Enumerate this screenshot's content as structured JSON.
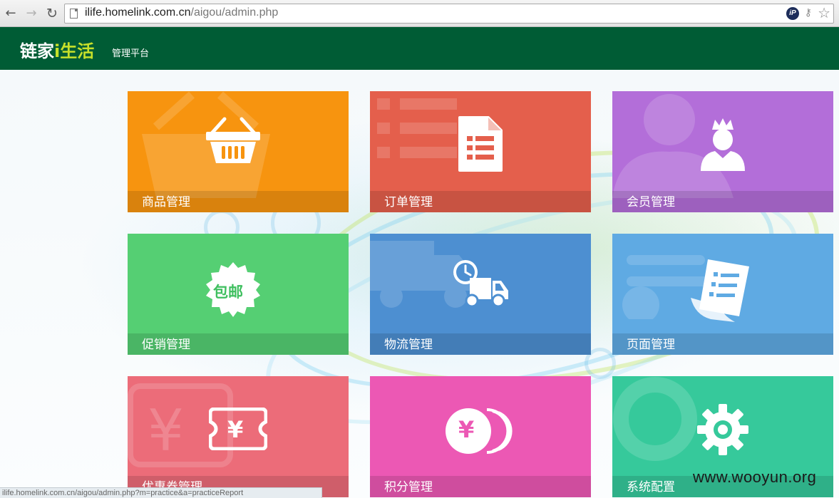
{
  "browser": {
    "url_host": "ilife.homelink.com.cn",
    "url_path": "/aigou/admin.php",
    "icons": [
      "back-arrow-icon",
      "forward-arrow-icon",
      "reload-icon",
      "page-icon",
      "ip-badge-icon",
      "key-icon",
      "bookmark-star-icon"
    ],
    "ip_badge": "iP"
  },
  "header": {
    "logo_main": "链家",
    "logo_accent": "i生活",
    "subtitle": "管理平台",
    "background": "#005c35"
  },
  "tiles": [
    {
      "label": "商品管理",
      "icon": "shopping-basket-icon",
      "color": "#f7940f"
    },
    {
      "label": "订单管理",
      "icon": "order-document-icon",
      "color": "#e45f4c"
    },
    {
      "label": "会员管理",
      "icon": "member-crown-icon",
      "color": "#b36ed9"
    },
    {
      "label": "促销管理",
      "icon": "free-shipping-badge-icon",
      "color": "#55cf73",
      "badge_text": "包邮"
    },
    {
      "label": "物流管理",
      "icon": "delivery-truck-icon",
      "color": "#4d8fd1"
    },
    {
      "label": "页面管理",
      "icon": "page-scroll-icon",
      "color": "#5faae3"
    },
    {
      "label": "优惠券管理",
      "icon": "coupon-ticket-icon",
      "color": "#ec6c79",
      "symbol": "¥"
    },
    {
      "label": "积分管理",
      "icon": "points-coins-icon",
      "color": "#ec58b4",
      "symbol": "¥"
    },
    {
      "label": "系统配置",
      "icon": "settings-gear-icon",
      "color": "#36c99b"
    }
  ],
  "status_bar": {
    "text": "ilife.homelink.com.cn/aigou/admin.php?m=practice&a=practiceReport"
  },
  "site_watermark": "www.wooyun.org"
}
